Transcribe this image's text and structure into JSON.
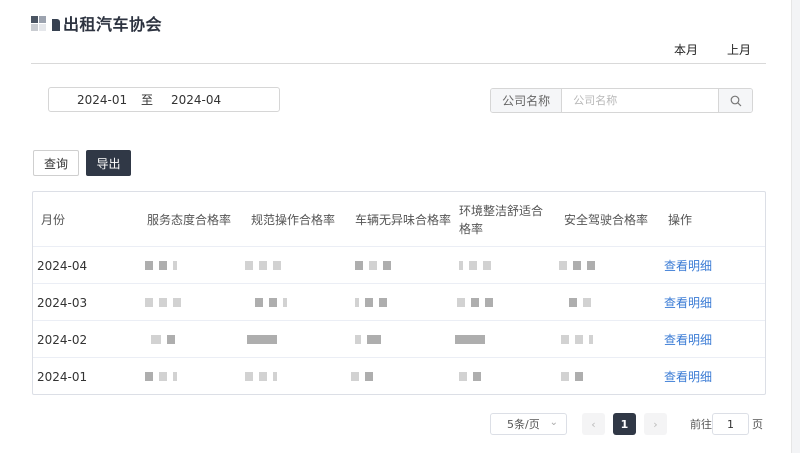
{
  "app": {
    "title": "出租汽车协会"
  },
  "period_tabs": {
    "current": "本月",
    "previous": "上月"
  },
  "filters": {
    "date_start": "2024-01",
    "date_separator": "至",
    "date_end": "2024-04",
    "company_label": "公司名称",
    "company_placeholder": "公司名称",
    "company_value": ""
  },
  "actions": {
    "query_label": "查询",
    "export_label": "导出"
  },
  "table": {
    "columns": [
      "月份",
      "服务态度合格率",
      "规范操作合格率",
      "车辆无异味合格率",
      "环境整洁舒适合格率",
      "安全驾驶合格率",
      "操作"
    ],
    "rows": [
      {
        "month": "2024-04",
        "action": "查看明细"
      },
      {
        "month": "2024-03",
        "action": "查看明细"
      },
      {
        "month": "2024-02",
        "action": "查看明细"
      },
      {
        "month": "2024-01",
        "action": "查看明细"
      }
    ]
  },
  "pagination": {
    "page_size": "5条/页",
    "current_page": "1",
    "goto_label": "前往",
    "goto_value": "1",
    "goto_suffix": "页"
  },
  "colors": {
    "primary_dark": "#303846",
    "link": "#3a7bd5"
  }
}
